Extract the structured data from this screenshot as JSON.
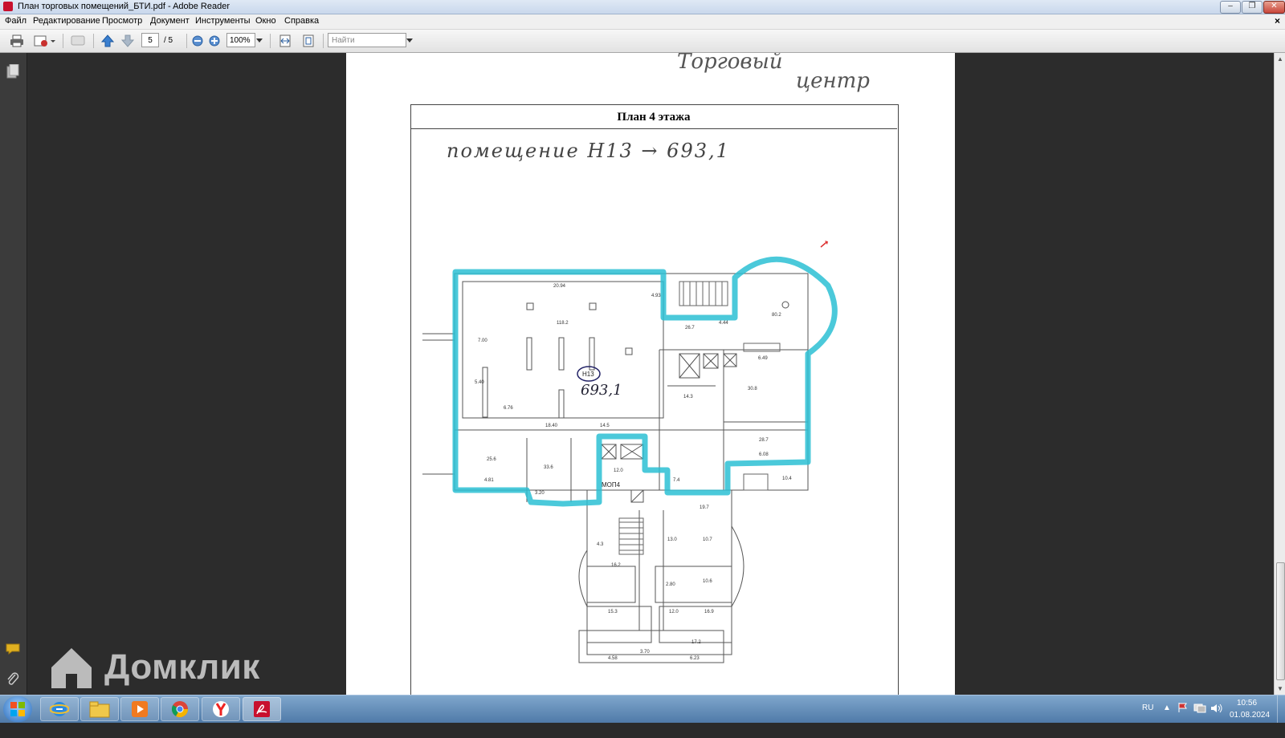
{
  "window": {
    "title": "План торговых помещений_БТИ.pdf - Adobe Reader",
    "controls": {
      "minimize": "–",
      "restore": "❐",
      "close": "✕"
    }
  },
  "menu": {
    "items": [
      "Файл",
      "Редактирование",
      "Просмотр",
      "Документ",
      "Инструменты",
      "Окно",
      "Справка"
    ],
    "doc_close": "×"
  },
  "toolbar": {
    "page_current": "5",
    "page_total": "/ 5",
    "zoom": "100%",
    "search_placeholder": "Найти"
  },
  "document": {
    "handwritten_top": [
      "Торговый",
      "центр"
    ],
    "plan_title": "План 4 этажа",
    "handwritten_note": "помещение Н13 → 693,1",
    "room_id": "Н13",
    "room_area": "693,1",
    "mop_label": "МОП4",
    "dimension_labels": [
      "20.94",
      "118.2",
      "7.00",
      "4.93",
      "26.7",
      "4.44",
      "80.2",
      "6.49",
      "30.8",
      "14.3",
      "25.6",
      "33.6",
      "14.5",
      "18.40",
      "6.76",
      "5.40",
      "4.81",
      "3.20",
      "12.0",
      "7.4",
      "28.7",
      "6.08",
      "10.4",
      "4.3",
      "19.7",
      "10.7",
      "13.0",
      "16.2",
      "10.6",
      "2.80",
      "15.3",
      "16.9",
      "12.0",
      "17.2",
      "3.70",
      "4.58",
      "6.23"
    ]
  },
  "watermark": {
    "text": "Домклик"
  },
  "tray": {
    "language": "RU",
    "time": "10:56",
    "date": "01.08.2024"
  },
  "colors": {
    "highlight": "#2bbfd3",
    "background": "#2c2c2c",
    "taskbar": "#5a85b2"
  }
}
